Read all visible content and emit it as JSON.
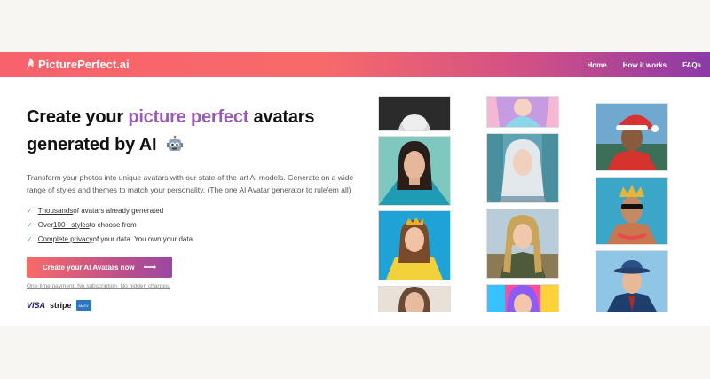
{
  "brand": {
    "name": "PicturePerfect.ai"
  },
  "nav": {
    "links": [
      "Home",
      "How it works",
      "FAQs"
    ]
  },
  "hero": {
    "title_part1": "Create your ",
    "title_accent": "picture perfect",
    "title_part2": " avatars",
    "title_line2": "generated by AI",
    "description": "Transform your photos into unique avatars with our state-of-the-art AI models. Generate on a wide range of styles and themes to match your personality. (The one AI Avatar generator to rule'em all)",
    "features": [
      {
        "highlight": "Thousands",
        "rest": " of avatars already generated"
      },
      {
        "prefix": "Over ",
        "highlight": "100+ styles",
        "rest": " to choose from"
      },
      {
        "highlight": "Complete privacy",
        "rest": " of your data. You own your data."
      }
    ],
    "cta_label": "Create your AI Avatars now",
    "fine_print": "One-time payment. No subscription. No hidden charges.",
    "payments": [
      "VISA",
      "stripe",
      "AMEX"
    ]
  },
  "colors": {
    "accent": "#9b59b6",
    "nav_start": "#f7626c",
    "nav_end": "#8b3aa8"
  },
  "gallery": {
    "avatars": [
      "grayscale-portrait",
      "woman-dark-hair",
      "woman-tiara-yellow-dress",
      "woman-close-up",
      "pastel-portrait",
      "silver-haired-elf",
      "blonde-braided-woman",
      "rainbow-portrait",
      "man-santa-hat",
      "man-crown-sunglasses",
      "man-blue-fedora"
    ]
  }
}
